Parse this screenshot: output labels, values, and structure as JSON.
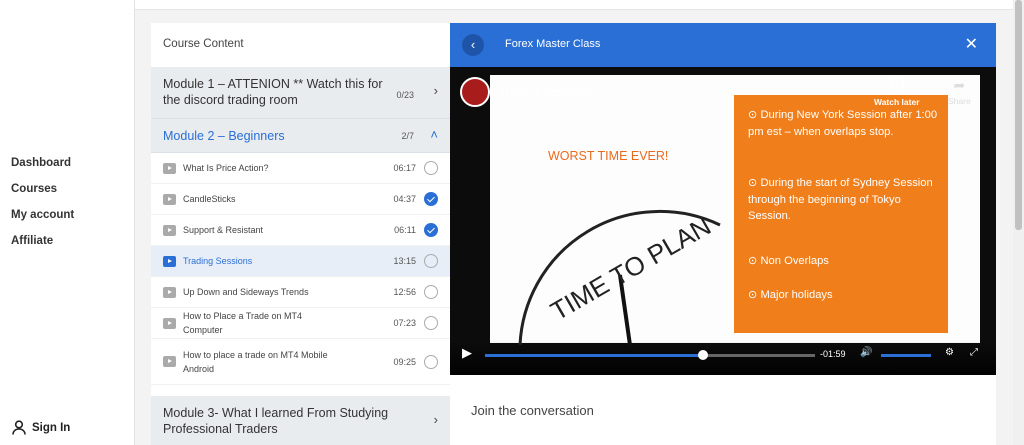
{
  "nav": {
    "items": [
      "Dashboard",
      "Courses",
      "My account",
      "Affiliate"
    ],
    "signin": "Sign In"
  },
  "course": {
    "section_title": "Course Content",
    "module1": {
      "title": "Module 1 – ATTENION ** Watch this for the discord trading room",
      "count": "0/23"
    },
    "module2": {
      "title": "Module 2 – Beginners",
      "count": "2/7"
    },
    "lessons": [
      {
        "title": "What Is Price Action?",
        "time": "06:17",
        "done": false,
        "active": false
      },
      {
        "title": "CandleSticks",
        "time": "04:37",
        "done": true,
        "active": false
      },
      {
        "title": "Support & Resistant",
        "time": "06:11",
        "done": true,
        "active": false
      },
      {
        "title": "Trading Sessions",
        "time": "13:15",
        "done": false,
        "active": true
      },
      {
        "title": "Up Down and Sideways Trends",
        "time": "12:56",
        "done": false,
        "active": false
      },
      {
        "title": "How to Place a Trade on MT4 Computer",
        "time": "07:23",
        "done": false,
        "active": false
      },
      {
        "title": "How to place a trade on MT4 Mobile Android",
        "time": "09:25",
        "done": false,
        "active": false
      }
    ],
    "module3": {
      "title": "Module 3- What I learned From Studying Professional Traders"
    }
  },
  "player": {
    "title": "Forex Master Class",
    "video_title": "Trading sessions",
    "watch_later": "Watch later",
    "share": "Share",
    "remaining": "-01:59",
    "progress": 0.66,
    "slide": {
      "worst": "WORST TIME EVER!",
      "bullets": [
        "⊙ During New York Session after 1:00 pm est – when overlaps stop.",
        "⊙ During the start of Sydney Session through the beginning of Tokyo Session.",
        "⊙ Non Overlaps",
        "⊙ Major holidays"
      ],
      "clock_text": "TIME TO PLAN"
    },
    "join": "Join the conversation"
  },
  "colors": {
    "accent": "#2a6fd6",
    "orange": "#f07e1b"
  }
}
